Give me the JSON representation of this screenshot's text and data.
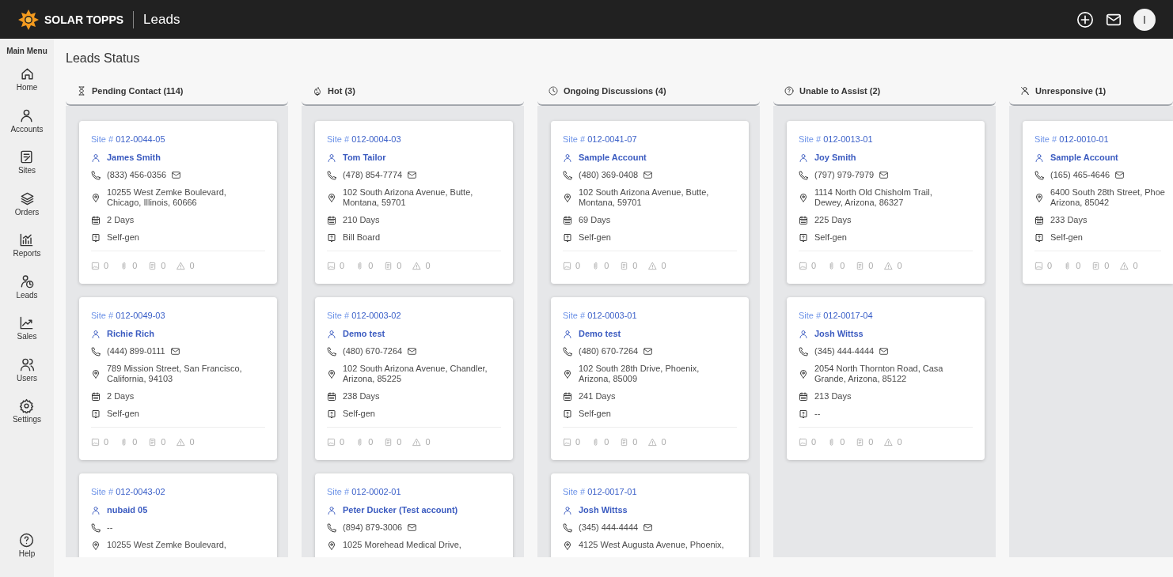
{
  "app": {
    "brand": "SOLAR TOPPS",
    "section": "Leads",
    "avatar_initial": "I"
  },
  "sidebar": {
    "title": "Main Menu",
    "items": [
      {
        "label": "Home"
      },
      {
        "label": "Accounts"
      },
      {
        "label": "Sites"
      },
      {
        "label": "Orders"
      },
      {
        "label": "Reports"
      },
      {
        "label": "Leads"
      },
      {
        "label": "Sales"
      },
      {
        "label": "Users"
      },
      {
        "label": "Settings"
      }
    ],
    "help": "Help"
  },
  "page_title": "Leads Status",
  "columns": [
    {
      "title": "Pending Contact (114)",
      "cards": [
        {
          "site": "Site # **012-0044-05**",
          "name": "James Smith",
          "phone": "(833) 456-0356",
          "has_email": true,
          "address": [
            "10255 West Zemke Boulevard,",
            "Chicago, Illinois, 60666"
          ],
          "days": "2 Days",
          "source": "Self-gen",
          "counts": [
            "0",
            "0",
            "0",
            "0"
          ]
        },
        {
          "site": "Site # **012-0049-03**",
          "name": "Richie Rich",
          "phone": "(444) 899-0111",
          "has_email": true,
          "address": [
            "789 Mission Street, San Francisco,",
            "California, 94103"
          ],
          "days": "2 Days",
          "source": "Self-gen",
          "counts": [
            "0",
            "0",
            "0",
            "0"
          ]
        },
        {
          "site": "Site # **012-0043-02**",
          "name": "nubaid 05",
          "phone": "--",
          "has_email": false,
          "address": [
            "10255 West Zemke Boulevard,"
          ]
        }
      ]
    },
    {
      "title": "Hot (3)",
      "cards": [
        {
          "site": "Site # **012-0004-03**",
          "name": "Tom Tailor",
          "phone": "(478) 854-7774",
          "has_email": true,
          "address": [
            "102 South Arizona Avenue, Butte,",
            "Montana, 59701"
          ],
          "days": "210 Days",
          "source": "Bill Board",
          "counts": [
            "0",
            "0",
            "0",
            "0"
          ]
        },
        {
          "site": "Site # **012-0003-02**",
          "name": "Demo test",
          "phone": "(480) 670-7264",
          "has_email": true,
          "address": [
            "102 South Arizona Avenue, Chandler,",
            "Arizona, 85225"
          ],
          "days": "238 Days",
          "source": "Self-gen",
          "counts": [
            "0",
            "0",
            "0",
            "0"
          ]
        },
        {
          "site": "Site # **012-0002-01**",
          "name": "Peter Ducker (Test account)",
          "phone": "(894) 879-3006",
          "has_email": true,
          "address": [
            "1025 Morehead Medical Drive,"
          ]
        }
      ]
    },
    {
      "title": "Ongoing Discussions (4)",
      "cards": [
        {
          "site": "Site # **012-0041-07**",
          "name": "Sample Account",
          "phone": "(480) 369-0408",
          "has_email": true,
          "address": [
            "102 South Arizona Avenue, Butte,",
            "Montana, 59701"
          ],
          "days": "69 Days",
          "source": "Self-gen",
          "counts": [
            "0",
            "0",
            "0",
            "0"
          ]
        },
        {
          "site": "Site # **012-0003-01**",
          "name": "Demo test",
          "phone": "(480) 670-7264",
          "has_email": true,
          "address": [
            "102 South 28th Drive, Phoenix,",
            "Arizona, 85009"
          ],
          "days": "241 Days",
          "source": "Self-gen",
          "counts": [
            "0",
            "0",
            "0",
            "0"
          ]
        },
        {
          "site": "Site # **012-0017-01**",
          "name": "Josh Wittss",
          "phone": "(345) 444-4444",
          "has_email": true,
          "address": [
            "4125 West Augusta Avenue, Phoenix,"
          ]
        }
      ]
    },
    {
      "title": "Unable to Assist (2)",
      "cards": [
        {
          "site": "Site # **012-0013-01**",
          "name": "Joy Smith",
          "phone": "(797) 979-7979",
          "has_email": true,
          "address": [
            "1114 North Old Chisholm Trail,",
            "Dewey, Arizona, 86327"
          ],
          "days": "225 Days",
          "source": "Self-gen",
          "counts": [
            "0",
            "0",
            "0",
            "0"
          ]
        },
        {
          "site": "Site # **012-0017-04**",
          "name": "Josh Wittss",
          "phone": "(345) 444-4444",
          "has_email": true,
          "address": [
            "2054 North Thornton Road, Casa",
            "Grande, Arizona, 85122"
          ],
          "days": "213 Days",
          "source": "--",
          "counts": [
            "0",
            "0",
            "0",
            "0"
          ]
        }
      ]
    },
    {
      "title": "Unresponsive (1)",
      "cards": [
        {
          "site": "Site # **012-0010-01**",
          "name": "Sample Account",
          "phone": "(165) 465-4646",
          "has_email": true,
          "address": [
            "6400 South 28th Street, Phoe",
            "Arizona, 85042"
          ],
          "days": "233 Days",
          "source": "Self-gen",
          "counts": [
            "0",
            "0",
            "0",
            "0"
          ]
        }
      ]
    }
  ]
}
